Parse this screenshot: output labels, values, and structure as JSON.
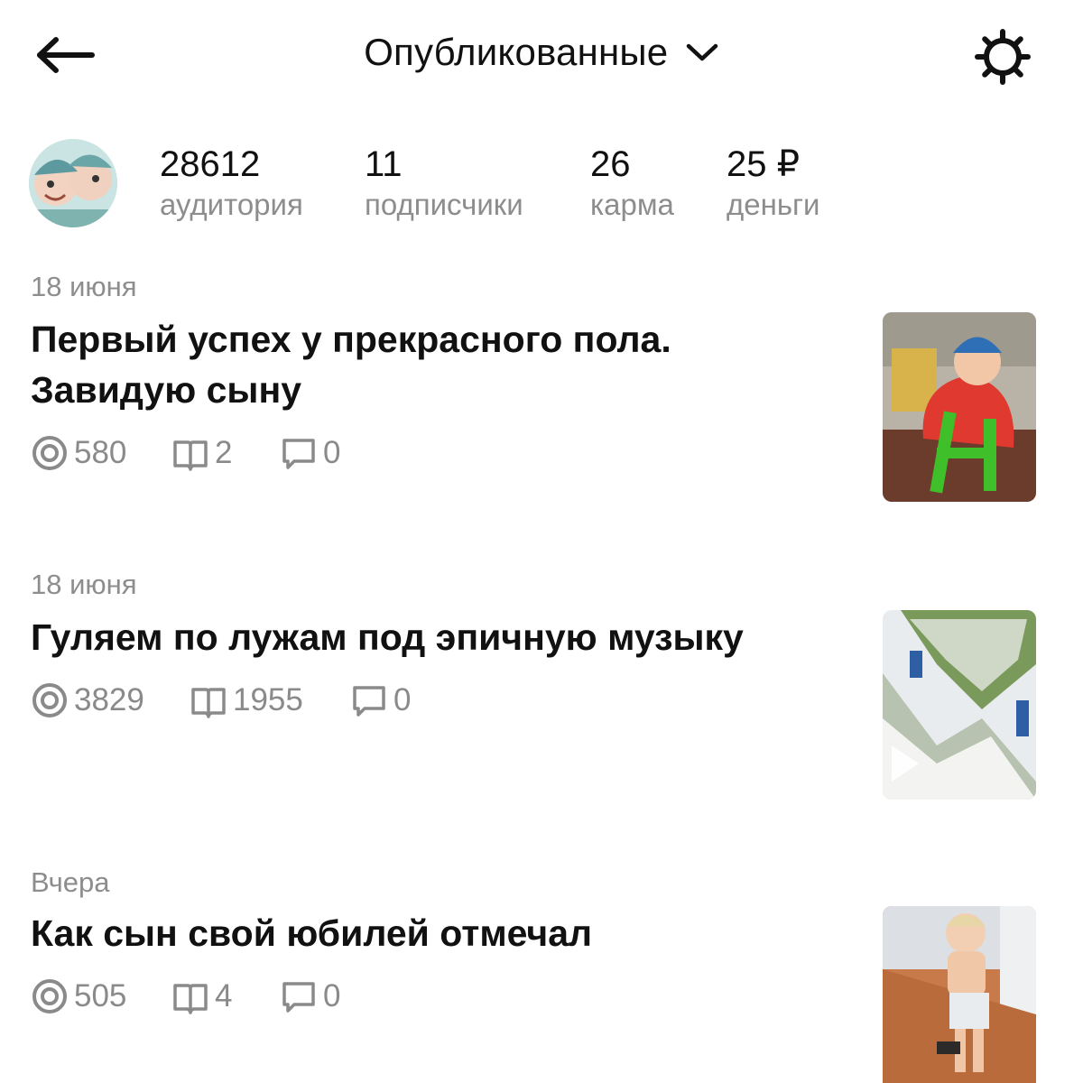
{
  "header": {
    "title": "Опубликованные",
    "back_icon": "arrow-left-icon",
    "dropdown_icon": "chevron-down-icon",
    "settings_icon": "gear-icon"
  },
  "profile": {
    "stats": [
      {
        "value": "28612",
        "label": "аудитория"
      },
      {
        "value": "11",
        "label": "подписчики"
      },
      {
        "value": "26",
        "label": "карма"
      },
      {
        "value": "25 ₽",
        "label": "деньги"
      }
    ]
  },
  "posts": [
    {
      "date": "18 июня",
      "title": "Первый успех у прекрасного пола. Завидую сыну",
      "views": "580",
      "reads": "2",
      "comments": "0"
    },
    {
      "date": "18 июня",
      "title": "Гуляем по лужам под эпичную музыку",
      "views": "3829",
      "reads": "1955",
      "comments": "0"
    },
    {
      "date": "Вчера",
      "title": "Как сын свой юбилей отмечал",
      "views": "505",
      "reads": "4",
      "comments": "0"
    }
  ],
  "colors": {
    "text": "#111111",
    "muted": "#8d8d8d",
    "icon": "#8a8a8a",
    "background": "#ffffff"
  }
}
